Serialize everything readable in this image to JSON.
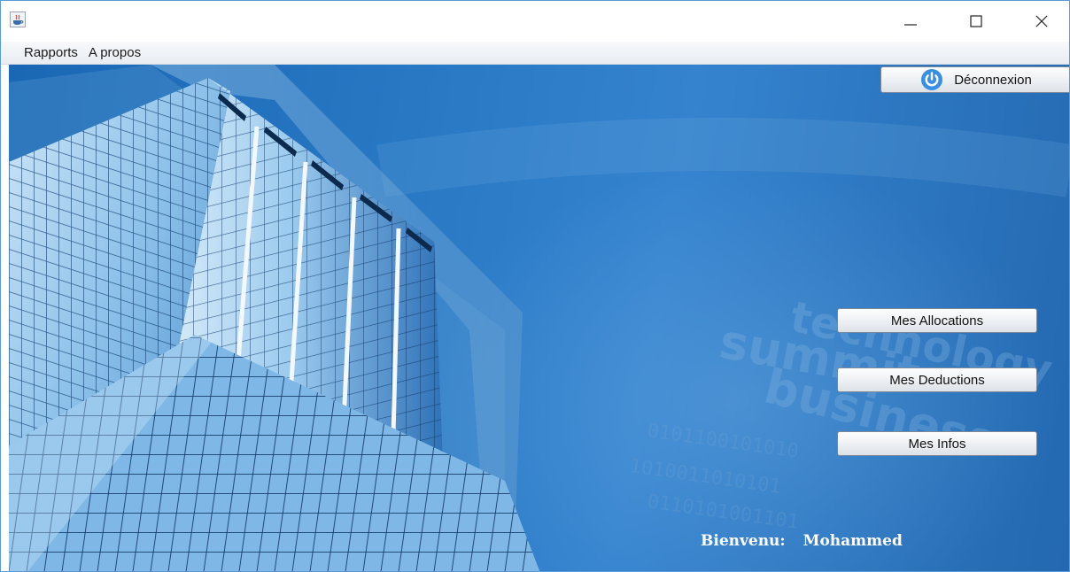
{
  "window": {
    "controls": {
      "minimize_icon": "minimize-icon",
      "maximize_icon": "maximize-icon",
      "close_icon": "close-icon"
    }
  },
  "menu": {
    "items": [
      {
        "label": "Rapports"
      },
      {
        "label": "A propos"
      }
    ]
  },
  "toolbar": {
    "logout_label": "Déconnexion",
    "logout_icon": "power-icon",
    "logout_icon_color": "#3b8fe0"
  },
  "actions": {
    "allocations_label": "Mes Allocations",
    "deductions_label": "Mes Deductions",
    "infos_label": "Mes Infos"
  },
  "welcome": {
    "label": "Bienvenu:",
    "user_name": "Mohammed"
  },
  "colors": {
    "background_blue": "#2a7ac6",
    "window_border": "#5a9bd5",
    "welcome_text": "#ffffff"
  }
}
